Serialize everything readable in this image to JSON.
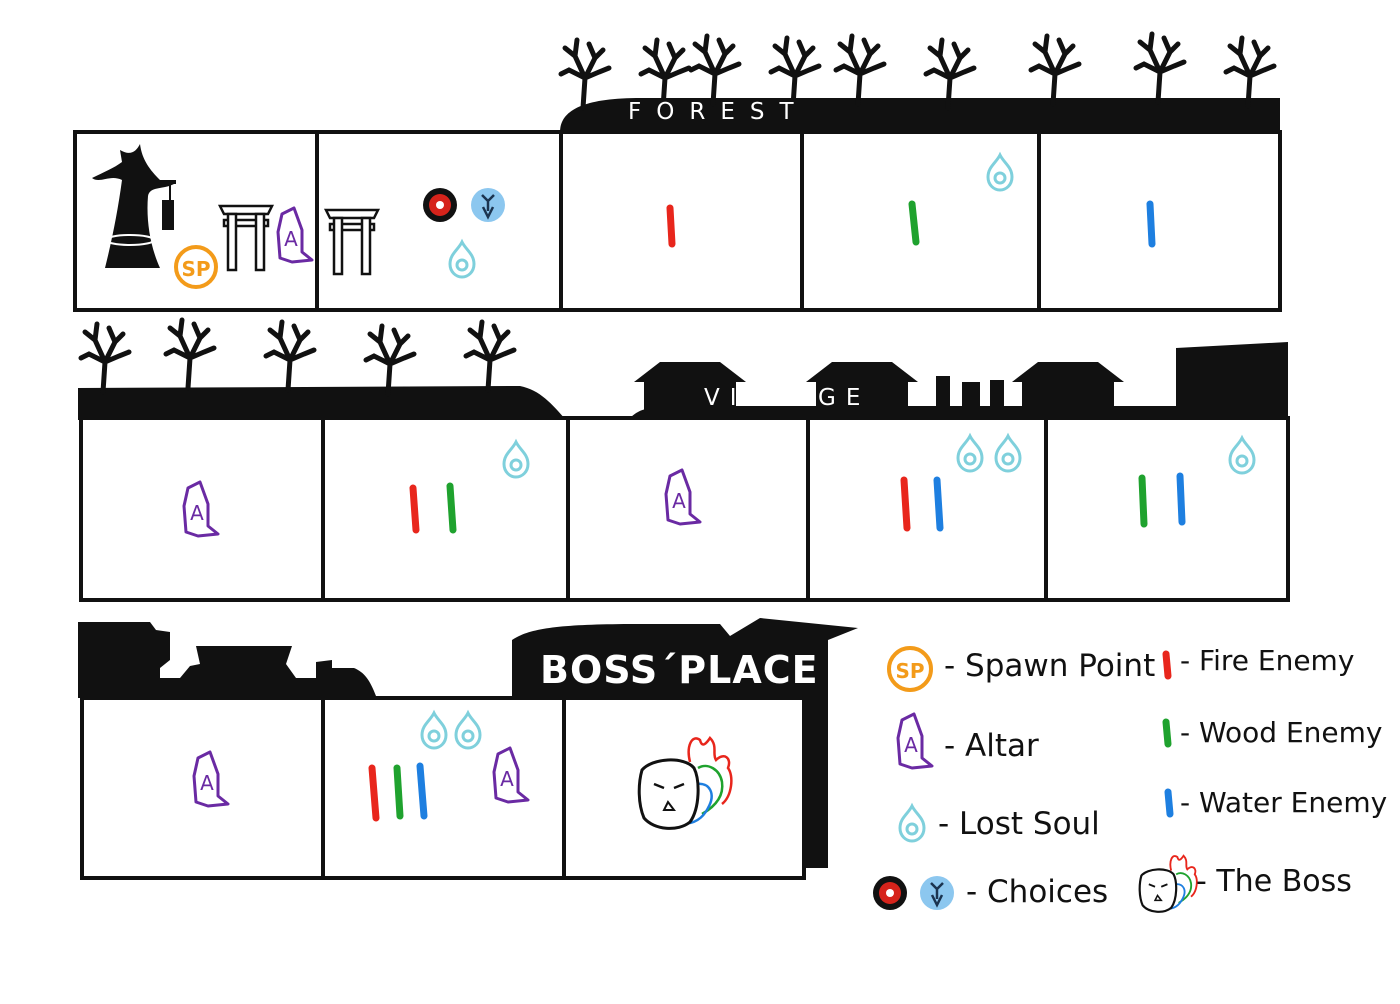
{
  "sections": {
    "forest": {
      "title": "FOREST"
    },
    "village": {
      "title": "VILLAGE"
    },
    "boss": {
      "title": "BOSS´PLACE"
    }
  },
  "icons": {
    "spawn": "SP",
    "altar": "A"
  },
  "legend": {
    "spawn_point": "- Spawn Point",
    "altar": "- Altar",
    "lost_soul": "- Lost Soul",
    "choices": "- Choices",
    "fire_enemy": "- Fire Enemy",
    "wood_enemy": "- Wood Enemy",
    "water_enemy": "- Water Enemy",
    "the_boss": "- The Boss"
  },
  "colors": {
    "fire": "#e8261c",
    "wood": "#1fa22e",
    "water": "#1e7fe0",
    "soul": "#7fd0dc",
    "altar": "#6a2aa3",
    "spawn": "#f39b1a",
    "ink": "#111111"
  }
}
